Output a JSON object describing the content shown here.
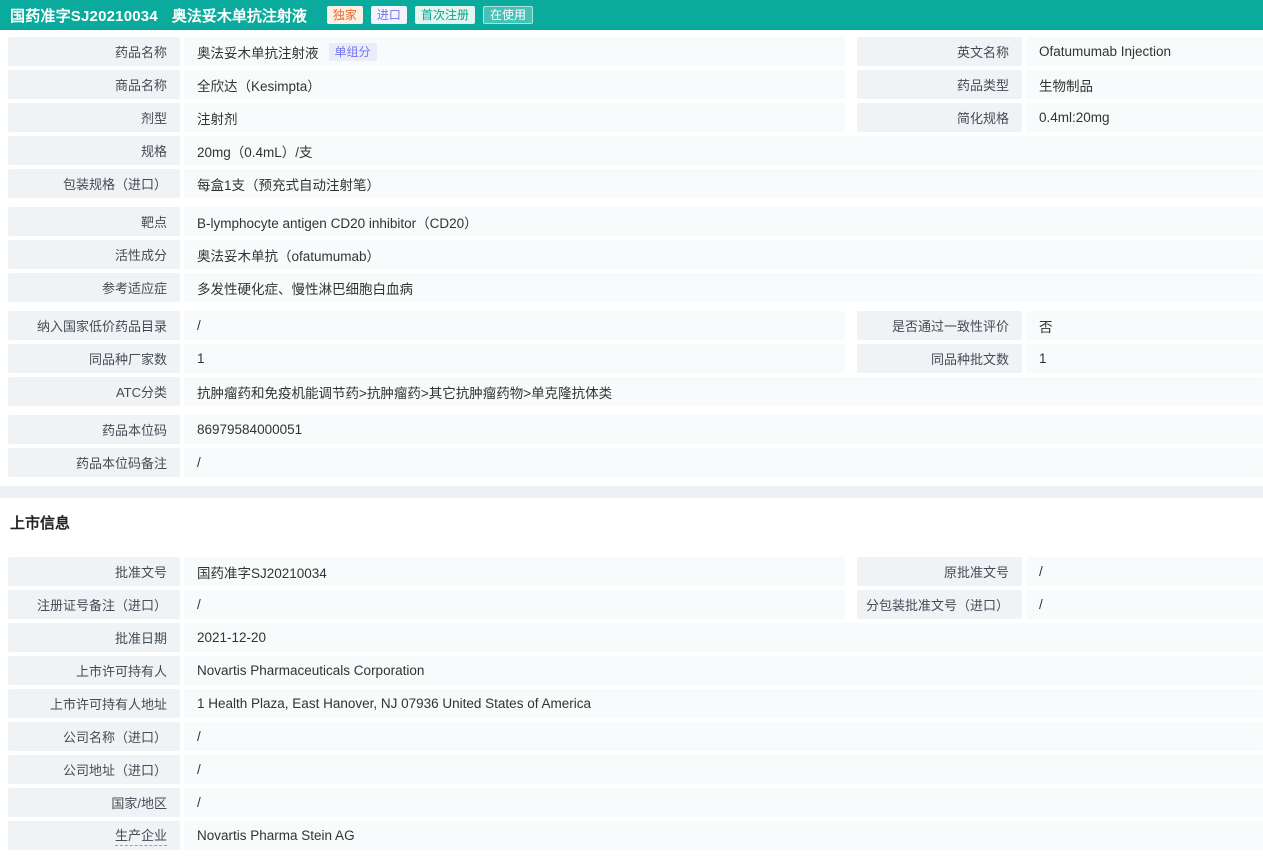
{
  "header": {
    "approval_no": "国药准字SJ20210034",
    "drug_name": "奥法妥木单抗注射液",
    "badges": [
      {
        "label": "独家",
        "type": "exclusive"
      },
      {
        "label": "进口",
        "type": "import"
      },
      {
        "label": "首次注册",
        "type": "first-reg"
      },
      {
        "label": "在使用",
        "type": "in-use"
      }
    ]
  },
  "colors": {
    "accent_teal": "#0aab9c",
    "label_cell_bg": "#eff3f6",
    "value_cell_bg": "#f8fbfb",
    "divider": "#edf0f5",
    "tag_purple": "#7476ee",
    "badge_orange": "#e8662b"
  },
  "sections": [
    {
      "name": "basic-info",
      "heading": null,
      "groups": [
        {
          "rows": [
            {
              "left": {
                "label": "药品名称",
                "value": "奥法妥木单抗注射液",
                "badge": "单组分"
              },
              "right": {
                "label": "英文名称",
                "value": "Ofatumumab Injection"
              }
            },
            {
              "left": {
                "label": "商品名称",
                "value": "全欣达（Kesimpta）"
              },
              "right": {
                "label": "药品类型",
                "value": "生物制品"
              }
            },
            {
              "left": {
                "label": "剂型",
                "value": "注射剂"
              },
              "right": {
                "label": "简化规格",
                "value": "0.4ml:20mg"
              }
            },
            {
              "left": {
                "label": "规格",
                "value": "20mg（0.4mL）/支"
              }
            },
            {
              "left": {
                "label": "包装规格（进口）",
                "value": "每盒1支（预充式自动注射笔）"
              }
            }
          ]
        },
        {
          "rows": [
            {
              "left": {
                "label": "靶点",
                "value": "B-lymphocyte antigen CD20 inhibitor（CD20）"
              }
            },
            {
              "left": {
                "label": "活性成分",
                "value": "奥法妥木单抗（ofatumumab）"
              }
            },
            {
              "left": {
                "label": "参考适应症",
                "value": "多发性硬化症、慢性淋巴细胞白血病"
              }
            }
          ]
        },
        {
          "rows": [
            {
              "left": {
                "label": "纳入国家低价药品目录",
                "value": "/"
              },
              "right": {
                "label": "是否通过一致性评价",
                "value": "否"
              }
            },
            {
              "left": {
                "label": "同品种厂家数",
                "value": "1"
              },
              "right": {
                "label": "同品种批文数",
                "value": "1"
              }
            },
            {
              "left": {
                "label": "ATC分类",
                "value": "抗肿瘤药和免疫机能调节药>抗肿瘤药>其它抗肿瘤药物>单克隆抗体类"
              },
              "full": true
            }
          ]
        },
        {
          "rows": [
            {
              "left": {
                "label": "药品本位码",
                "value": "86979584000051"
              }
            },
            {
              "left": {
                "label": "药品本位码备注",
                "value": "/"
              }
            }
          ]
        }
      ]
    },
    {
      "name": "market-info",
      "heading": "上市信息",
      "groups": [
        {
          "rows": [
            {
              "left": {
                "label": "批准文号",
                "value": "国药准字SJ20210034"
              },
              "right": {
                "label": "原批准文号",
                "value": "/"
              }
            },
            {
              "left": {
                "label": "注册证号备注（进口）",
                "value": "/"
              },
              "right": {
                "label": "分包装批准文号（进口）",
                "value": "/"
              }
            },
            {
              "left": {
                "label": "批准日期",
                "value": "2021-12-20"
              }
            },
            {
              "left": {
                "label": "上市许可持有人",
                "value": "Novartis Pharmaceuticals Corporation"
              }
            },
            {
              "left": {
                "label": "上市许可持有人地址",
                "value": "1 Health Plaza, East Hanover, NJ 07936 United States of America"
              }
            },
            {
              "left": {
                "label": "公司名称（进口）",
                "value": "/"
              }
            },
            {
              "left": {
                "label": "公司地址（进口）",
                "value": "/"
              }
            },
            {
              "left": {
                "label": "国家/地区",
                "value": "/"
              }
            },
            {
              "left": {
                "label": "生产企业",
                "value": "Novartis Pharma Stein AG",
                "label_dashed": true
              }
            }
          ]
        }
      ]
    }
  ]
}
